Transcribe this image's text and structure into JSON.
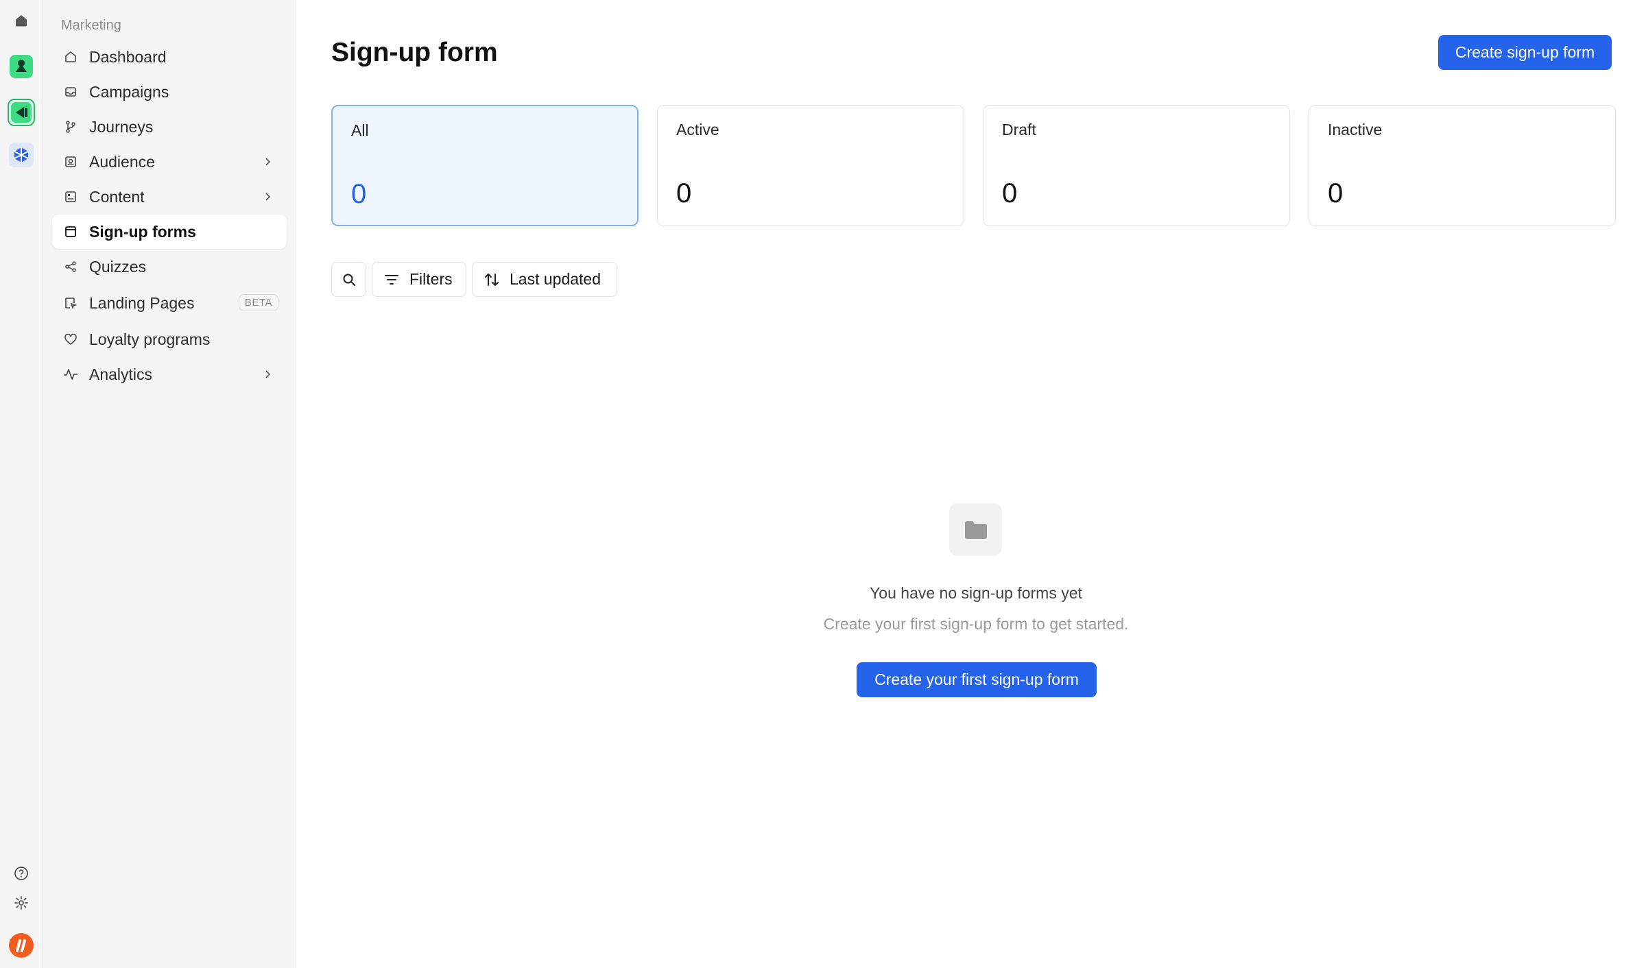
{
  "rail": {
    "items": [
      {
        "icon": "home-icon"
      },
      {
        "icon": "app-green-icon"
      },
      {
        "icon": "app-marketing-icon",
        "active": true
      },
      {
        "icon": "app-blue-icon"
      }
    ],
    "bottom": [
      {
        "icon": "help-icon"
      },
      {
        "icon": "settings-icon"
      },
      {
        "icon": "brand-logo-icon",
        "color": "#f25c1e"
      }
    ]
  },
  "sidebar": {
    "section_label": "Marketing",
    "items": [
      {
        "label": "Dashboard",
        "icon": "home-outline-icon"
      },
      {
        "label": "Campaigns",
        "icon": "inbox-icon"
      },
      {
        "label": "Journeys",
        "icon": "branch-icon"
      },
      {
        "label": "Audience",
        "icon": "contacts-icon",
        "has_submenu": true
      },
      {
        "label": "Content",
        "icon": "content-icon",
        "has_submenu": true
      },
      {
        "label": "Sign-up forms",
        "icon": "form-icon",
        "active": true
      },
      {
        "label": "Quizzes",
        "icon": "quiz-icon"
      },
      {
        "label": "Landing Pages",
        "icon": "landing-page-icon",
        "badge": "BETA"
      },
      {
        "label": "Loyalty programs",
        "icon": "heart-icon"
      },
      {
        "label": "Analytics",
        "icon": "activity-icon",
        "has_submenu": true
      }
    ]
  },
  "main": {
    "title": "Sign-up form",
    "create_label": "Create sign-up form",
    "stats": [
      {
        "label": "All",
        "value": "0",
        "selected": true
      },
      {
        "label": "Active",
        "value": "0"
      },
      {
        "label": "Draft",
        "value": "0"
      },
      {
        "label": "Inactive",
        "value": "0"
      }
    ],
    "toolbar": {
      "filters_label": "Filters",
      "sort_label": "Last updated"
    },
    "empty": {
      "title": "You have no sign-up forms yet",
      "subtitle": "Create your first sign-up form to get started.",
      "cta_label": "Create your first sign-up form"
    }
  },
  "colors": {
    "accent": "#2563eb",
    "selected_card_bg": "#eef5ff",
    "selected_card_border": "#7fb0f0",
    "sidebar_bg": "#f5f5f5"
  }
}
